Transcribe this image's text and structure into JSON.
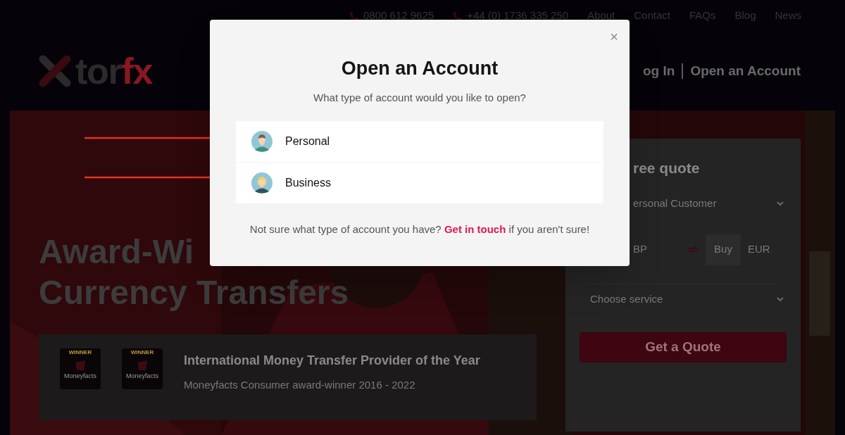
{
  "top_bar": {
    "phones": [
      "0800 612 9625",
      "+44 (0) 1736 335 250"
    ],
    "links": [
      "About",
      "Contact",
      "FAQs",
      "Blog",
      "News"
    ]
  },
  "header": {
    "logo": [
      "tor",
      "fx"
    ],
    "login": "og In",
    "open_account": "Open an Account"
  },
  "hero": {
    "title": [
      "Award-Wi",
      "Currency Transfers"
    ],
    "award": {
      "badges": [
        {
          "top": "WINNER",
          "name": "Moneyfacts"
        },
        {
          "top": "WINNER",
          "name": "Moneyfacts"
        }
      ],
      "title": "International Money Transfer Provider of the Year",
      "subtitle": "Moneyfacts Consumer award-winner 2016 - 2022"
    }
  },
  "quote_form": {
    "title": "ree quote",
    "customer_type": "ersonal Customer",
    "sell": "BP",
    "buy_label": "Buy",
    "buy": "EUR",
    "service": "Choose service",
    "button": "Get a Quote"
  },
  "modal": {
    "close": "×",
    "title": "Open an Account",
    "subtitle": "What type of account would you like to open?",
    "options": [
      {
        "label": "Personal",
        "kind": "man"
      },
      {
        "label": "Business",
        "kind": "woman"
      }
    ],
    "footer": {
      "before": "Not sure what type of account you have?",
      "link": "Get in touch",
      "after": "if you aren't sure!"
    }
  },
  "annotations": [
    {
      "kind": "arrow"
    },
    {
      "kind": "arrow"
    }
  ]
}
